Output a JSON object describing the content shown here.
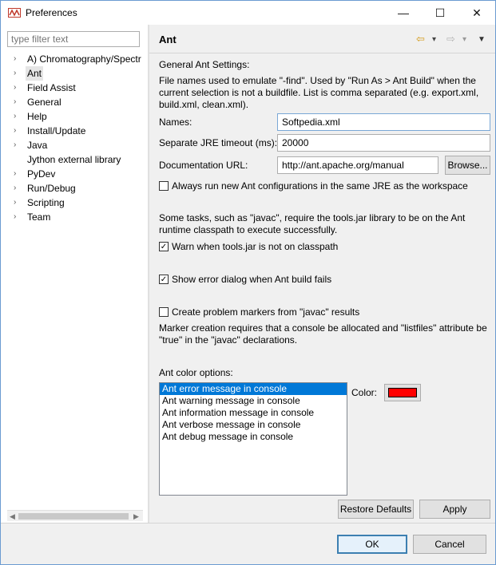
{
  "window": {
    "title": "Preferences",
    "minimize_glyph": "—",
    "maximize_glyph": "☐",
    "close_glyph": "✕"
  },
  "sidebar": {
    "filter_placeholder": "type filter text",
    "items": [
      {
        "label": "A) Chromatography/Spectr",
        "chevron": "›"
      },
      {
        "label": "Ant",
        "chevron": "›",
        "selected": true
      },
      {
        "label": "Field Assist",
        "chevron": "›"
      },
      {
        "label": "General",
        "chevron": "›"
      },
      {
        "label": "Help",
        "chevron": "›"
      },
      {
        "label": "Install/Update",
        "chevron": "›"
      },
      {
        "label": "Java",
        "chevron": "›"
      },
      {
        "label": "Jython external library",
        "chevron": ""
      },
      {
        "label": "PyDev",
        "chevron": "›"
      },
      {
        "label": "Run/Debug",
        "chevron": "›"
      },
      {
        "label": "Scripting",
        "chevron": "›"
      },
      {
        "label": "Team",
        "chevron": "›"
      }
    ]
  },
  "page": {
    "title": "Ant",
    "general_settings": "General Ant Settings:",
    "find_desc_1": "File names used to emulate \"-find\". Used by \"Run As > Ant Build\" when the",
    "find_desc_2": "current selection is not a buildfile. List is comma separated (e.g. export.xml,",
    "find_desc_3": "build.xml, clean.xml).",
    "names_label": "Names:",
    "names_value": "Softpedia.xml",
    "jre_label": "Separate JRE timeout (ms):",
    "jre_value": "20000",
    "doc_label": "Documentation URL:",
    "doc_value": "http://ant.apache.org/manual",
    "browse_label": "Browse...",
    "always_run_label": "Always run new Ant configurations in the same JRE as the workspace",
    "tools_desc_1": "Some tasks, such as \"javac\", require the tools.jar library to be on the Ant",
    "tools_desc_2": "runtime classpath to execute successfully.",
    "warn_tools_label": "Warn when tools.jar is not on classpath",
    "show_error_label": "Show error dialog when Ant build fails",
    "problem_markers_label": "Create problem markers from \"javac\" results",
    "marker_desc_1": "Marker creation requires that a console be allocated and \"listfiles\" attribute be",
    "marker_desc_2": "\"true\" in the \"javac\" declarations.",
    "color_options_label": "Ant color options:",
    "color_items": [
      "Ant error message in console",
      "Ant warning message in console",
      "Ant information message in console",
      "Ant verbose message in console",
      "Ant debug message in console"
    ],
    "color_label": "Color:",
    "color_value": "#ff0000",
    "restore_defaults": "Restore Defaults",
    "apply": "Apply",
    "checked_glyph": "✓"
  },
  "footer": {
    "ok": "OK",
    "cancel": "Cancel"
  },
  "icons": {
    "back_arrow": "⇦",
    "forward_arrow": "⇨",
    "dropdown": "▾",
    "menu": "▼",
    "scroll_left": "◀",
    "scroll_right": "▶"
  }
}
